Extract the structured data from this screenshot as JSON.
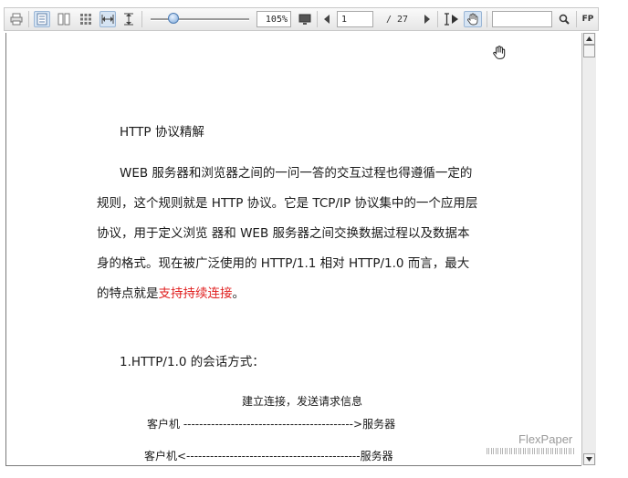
{
  "toolbar": {
    "icons": [
      "print-icon",
      "single-page-icon",
      "two-page-icon",
      "thumbnail-icon",
      "fit-width-icon",
      "fit-height-icon",
      "fullscreen-icon",
      "prev-page-icon",
      "next-page-icon",
      "text-select-icon",
      "hand-icon",
      "search-icon"
    ],
    "zoom": "105%",
    "zoom_level": 0.2,
    "page_input": "1",
    "page_total": "/ 27",
    "search_value": "",
    "brand": "FP"
  },
  "document": {
    "title": "HTTP 协议精解",
    "para1": [
      "WEB 服务器和浏览器之间的一问一答的交互过程也得遵循一定的",
      "规则，这个规则就是 HTTP 协议。它是 TCP/IP 协议集中的一个应用层",
      "协议，用于定义浏览  器和 WEB 服务器之间交换数据过程以及数据本",
      "身的格式。现在被广泛使用的 HTTP/1.1 相对 HTTP/1.0 而言，最大"
    ],
    "para1_last_prefix": "的特点就是",
    "para1_highlight": "支持持续连接",
    "para1_suffix": "。",
    "section_heading": "1.HTTP/1.0 的会话方式：",
    "diagram_caption": "建立连接，发送请求信息",
    "diagram_row1": "客户机 ------------------------------------------->服务器",
    "diagram_row2": "客户机<--------------------------------------------服务器"
  },
  "watermark": "FlexPaper",
  "colors": {
    "highlight": "#e02020",
    "accent": "#4a90d9"
  }
}
